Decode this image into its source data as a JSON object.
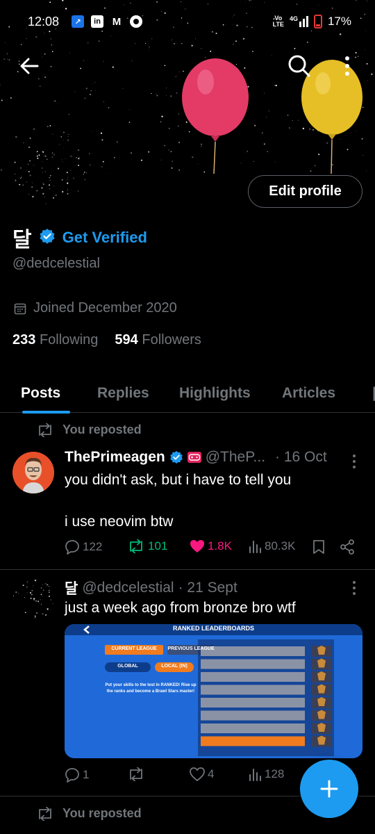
{
  "status_bar": {
    "time": "12:08",
    "network_top": "Vo",
    "network_bottom": "LTE",
    "signal_label": "4G",
    "battery": "17%"
  },
  "profile": {
    "display_name": "달",
    "verify_cta": "Get Verified",
    "handle": "@dedcelestial",
    "joined": "Joined December 2020",
    "following_count": "233",
    "following_label": "Following",
    "followers_count": "594",
    "followers_label": "Followers",
    "edit_label": "Edit profile"
  },
  "tabs": [
    {
      "label": "Posts",
      "active": true
    },
    {
      "label": "Replies",
      "active": false
    },
    {
      "label": "Highlights",
      "active": false
    },
    {
      "label": "Articles",
      "active": false
    }
  ],
  "posts": [
    {
      "repost_label": "You reposted",
      "author": "ThePrimeagen",
      "handle": "@TheP...",
      "time": "· 16 Oct",
      "text_line1": "you didn't ask, but i have to tell you",
      "text_line2": "i use neovim btw",
      "replies": "122",
      "reposts": "101",
      "likes": "1.8K",
      "views": "80.3K"
    },
    {
      "author": "달",
      "handle": "@dedcelestial",
      "time": "· 21 Sept",
      "text": "just a week ago from bronze bro wtf",
      "replies": "1",
      "reposts": "",
      "likes": "4",
      "views": "128",
      "media": {
        "title": "RANKED LEADERBOARDS",
        "btn_current": "CURRENT LEAGUE",
        "btn_previous": "PREVIOUS LEAGUE",
        "btn_global": "GLOBAL",
        "btn_local": "LOCAL (IN)",
        "promo": "Put your skills to the test in RANKED! Rise up the ranks and become a Brawl Stars master!"
      }
    },
    {
      "repost_label": "You reposted"
    }
  ],
  "colors": {
    "accent": "#1d9bf0",
    "muted": "#71767b",
    "repost_green": "#00ba7c",
    "like_pink": "#f91880"
  }
}
